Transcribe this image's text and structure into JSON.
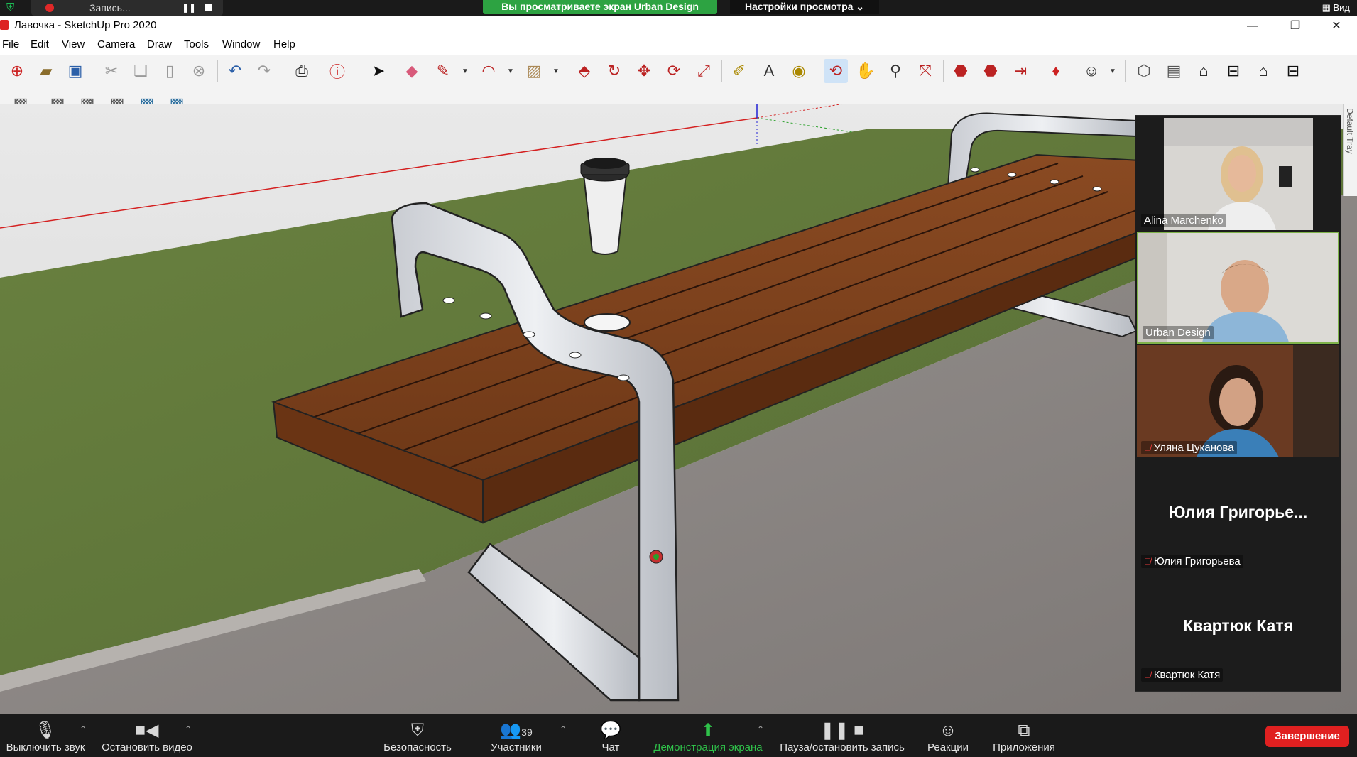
{
  "zoom_top": {
    "recording_label": "Запись...",
    "share_banner": "Вы просматриваете экран Urban Design",
    "view_settings": "Настройки просмотра ⌄",
    "view_right": "Вид"
  },
  "sketchup": {
    "title": "Лавочка - SketchUp Pro 2020",
    "menu": [
      "File",
      "Edit",
      "View",
      "Camera",
      "Draw",
      "Tools",
      "Window",
      "Help"
    ],
    "default_tray": "Default Tray"
  },
  "participants": [
    {
      "name": "Alina Marchenko",
      "video": true,
      "muted": false
    },
    {
      "name": "Urban Design",
      "video": true,
      "muted": false,
      "speaking": true
    },
    {
      "name": "Уляна Цуканова",
      "video": true,
      "muted": true
    },
    {
      "name": "Юлия Григорьева",
      "display": "Юлия Григорье...",
      "video": false,
      "muted": true
    },
    {
      "name": "Квартюк Катя",
      "display": "Квартюк Катя",
      "video": false,
      "muted": true
    }
  ],
  "zoom_bottom": {
    "mute": "Выключить звук",
    "stop_video": "Остановить видео",
    "security": "Безопасность",
    "participants": "Участники",
    "participants_count": "39",
    "chat": "Чат",
    "share": "Демонстрация экрана",
    "record": "Пауза/остановить запись",
    "reactions": "Реакции",
    "apps": "Приложения",
    "end": "Завершение"
  },
  "colors": {
    "share_green": "#2da342",
    "end_red": "#e02020",
    "wood": "#7a3f1d",
    "grass": "#5f7a3a",
    "asphalt": "#8a8684"
  }
}
